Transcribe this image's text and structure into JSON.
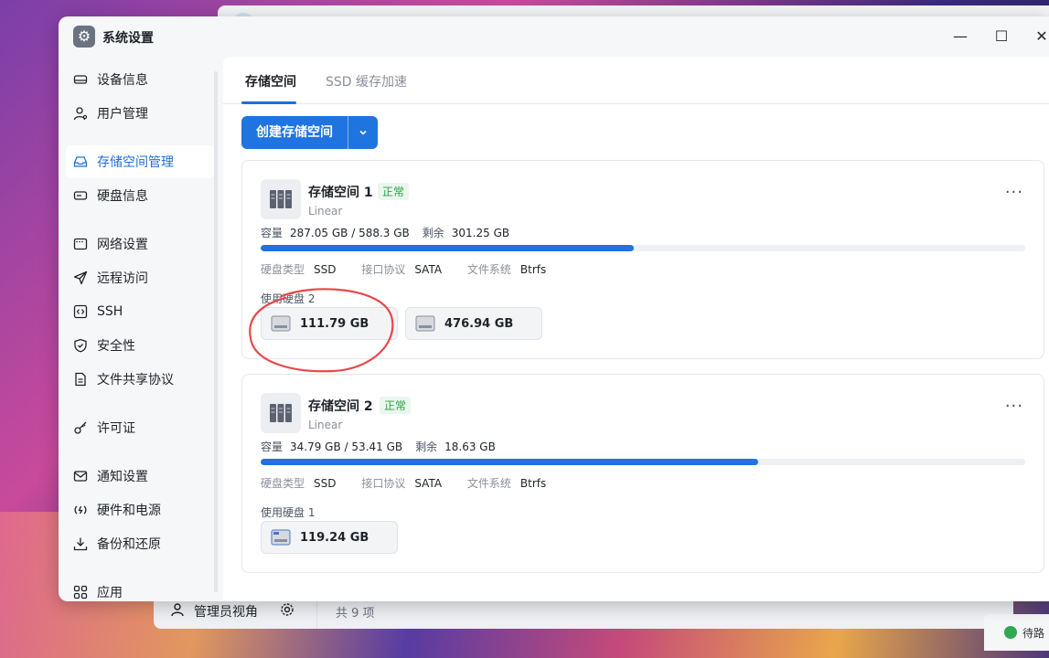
{
  "window": {
    "title": "系统设置",
    "minimize": "—",
    "maximize": "☐",
    "close": "✕"
  },
  "sidebar": {
    "items": [
      {
        "label": "设备信息",
        "icon": "hdd-icon"
      },
      {
        "label": "用户管理",
        "icon": "user-icon"
      },
      {
        "label": "存储空间管理",
        "icon": "inbox-icon",
        "active": true
      },
      {
        "label": "硬盘信息",
        "icon": "disk-icon"
      },
      {
        "label": "网络设置",
        "icon": "monitor-icon"
      },
      {
        "label": "远程访问",
        "icon": "send-icon"
      },
      {
        "label": "SSH",
        "icon": "code-icon"
      },
      {
        "label": "安全性",
        "icon": "shield-icon"
      },
      {
        "label": "文件共享协议",
        "icon": "file-icon"
      },
      {
        "label": "许可证",
        "icon": "key-icon"
      },
      {
        "label": "通知设置",
        "icon": "mail-icon"
      },
      {
        "label": "硬件和电源",
        "icon": "power-icon"
      },
      {
        "label": "备份和还原",
        "icon": "download-icon"
      },
      {
        "label": "应用",
        "icon": "apps-icon"
      }
    ]
  },
  "tabs": [
    {
      "label": "存储空间",
      "active": true
    },
    {
      "label": "SSD 缓存加速",
      "active": false
    }
  ],
  "create_button": {
    "label": "创建存储空间"
  },
  "pools": [
    {
      "name": "存储空间 1",
      "status": "正常",
      "raid": "Linear",
      "capacity_label": "容量",
      "used": "287.05 GB",
      "total": "588.3 GB",
      "used_sep": "/",
      "remaining_label": "剩余",
      "remaining": "301.25 GB",
      "usage_fraction": 0.488,
      "disk_type_label": "硬盘类型",
      "disk_type": "SSD",
      "interface_label": "接口协议",
      "interface": "SATA",
      "fs_label": "文件系统",
      "fs": "Btrfs",
      "disks_label": "使用硬盘 2",
      "disks": [
        "111.79 GB",
        "476.94 GB"
      ]
    },
    {
      "name": "存储空间 2",
      "status": "正常",
      "raid": "Linear",
      "capacity_label": "容量",
      "used": "34.79 GB",
      "total": "53.41 GB",
      "used_sep": "/",
      "remaining_label": "剩余",
      "remaining": "18.63 GB",
      "usage_fraction": 0.651,
      "disk_type_label": "硬盘类型",
      "disk_type": "SSD",
      "interface_label": "接口协议",
      "interface": "SATA",
      "fs_label": "文件系统",
      "fs": "Btrfs",
      "disks_label": "使用硬盘 1",
      "disks": [
        "119.24 GB"
      ]
    }
  ],
  "bottom_bar": {
    "view_label": "管理员视角",
    "count": "共 9 项"
  },
  "corner_badge": {
    "text": "待路"
  },
  "colors": {
    "accent": "#1f74e0",
    "status_ok": "#2ea043",
    "annotation": "#e8484a"
  }
}
